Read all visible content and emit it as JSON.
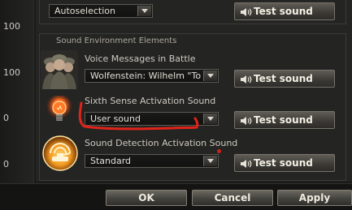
{
  "left_values": [
    "100",
    "100",
    "0",
    "0"
  ],
  "top_row": {
    "select_value": "Autoselection",
    "button_label": "Test sound"
  },
  "section": {
    "title": "Sound Environment Elements"
  },
  "rows": [
    {
      "label": "Voice Messages in Battle",
      "select_value": "Wolfenstein: Wilhelm \"To",
      "button_label": "Test sound",
      "icon": "soldiers-portrait-icon"
    },
    {
      "label": "Sixth Sense Activation Sound",
      "select_value": "User sound",
      "button_label": "Test sound",
      "icon": "lightbulb-icon"
    },
    {
      "label": "Sound Detection Activation Sound",
      "select_value": "Standard",
      "button_label": "Test sound",
      "icon": "radar-tank-icon"
    }
  ],
  "footer": {
    "ok_label": "OK",
    "cancel_label": "Cancel",
    "apply_label": "Apply"
  },
  "colors": {
    "annotation": "#e0241a",
    "button_text": "#f3efe4",
    "background": "#242423"
  }
}
